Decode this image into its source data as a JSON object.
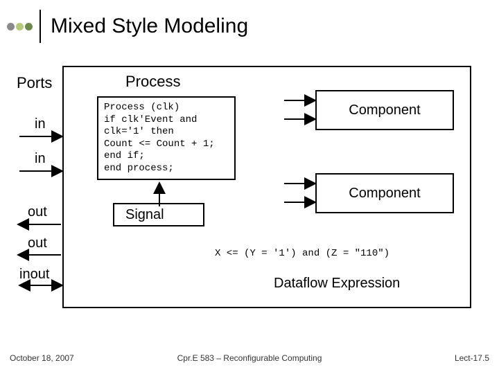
{
  "title": "Mixed Style Modeling",
  "dots": [
    "#8a8a8a",
    "#b6c97b",
    "#6b8a4a"
  ],
  "ports": {
    "heading": "Ports",
    "items": [
      "in",
      "in",
      "out",
      "out",
      "inout"
    ]
  },
  "process": {
    "heading": "Process",
    "code": "Process (clk)\nif clk'Event and\nclk='1' then\nCount <= Count + 1;\nend if;\nend process;"
  },
  "components": {
    "label1": "Component",
    "label2": "Component"
  },
  "signal_label": "Signal",
  "dataflow": {
    "code": "X <= (Y = '1') and (Z = \"110\")",
    "label": "Dataflow Expression"
  },
  "footer": {
    "left": "October 18, 2007",
    "center": "Cpr.E 583 – Reconfigurable Computing",
    "right": "Lect-17.5"
  }
}
